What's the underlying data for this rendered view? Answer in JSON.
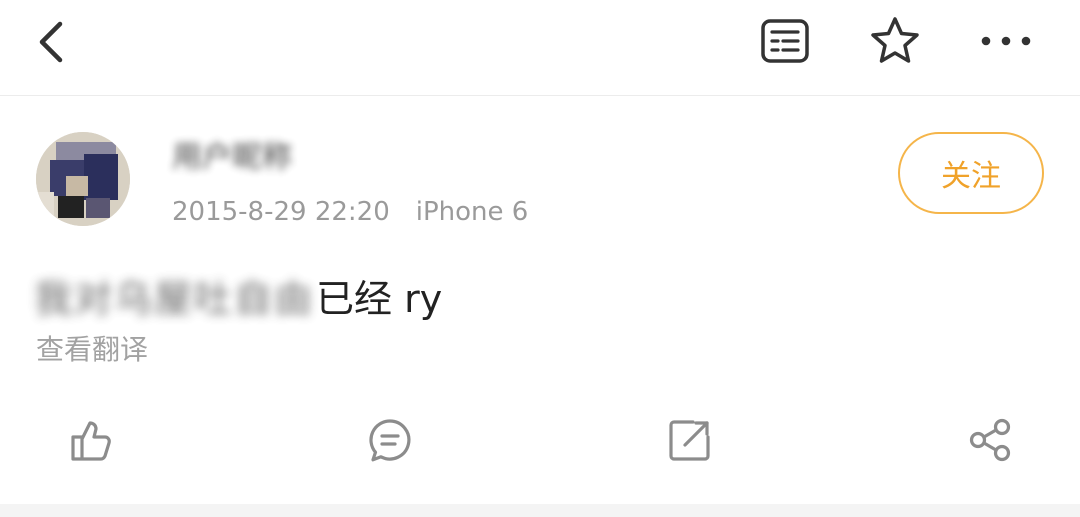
{
  "post": {
    "username": "用户昵称",
    "timestamp": "2015-8-29 22:20",
    "device": "iPhone 6",
    "follow_label": "关注",
    "content_hidden": "我对乌屋吐自由",
    "content_visible": "已经 ry",
    "translate_label": "查看翻译"
  },
  "icons": {
    "back": "chevron-left-icon",
    "reader": "reader-mode-icon",
    "favorite": "star-icon",
    "more": "more-dots-icon",
    "like": "thumbs-up-icon",
    "comment": "comment-icon",
    "repost": "repost-icon",
    "share": "share-icon"
  },
  "colors": {
    "accent": "#f0a22a",
    "meta_text": "#9a9a9a",
    "icon": "#333333",
    "action_icon": "#8c8c8c"
  }
}
